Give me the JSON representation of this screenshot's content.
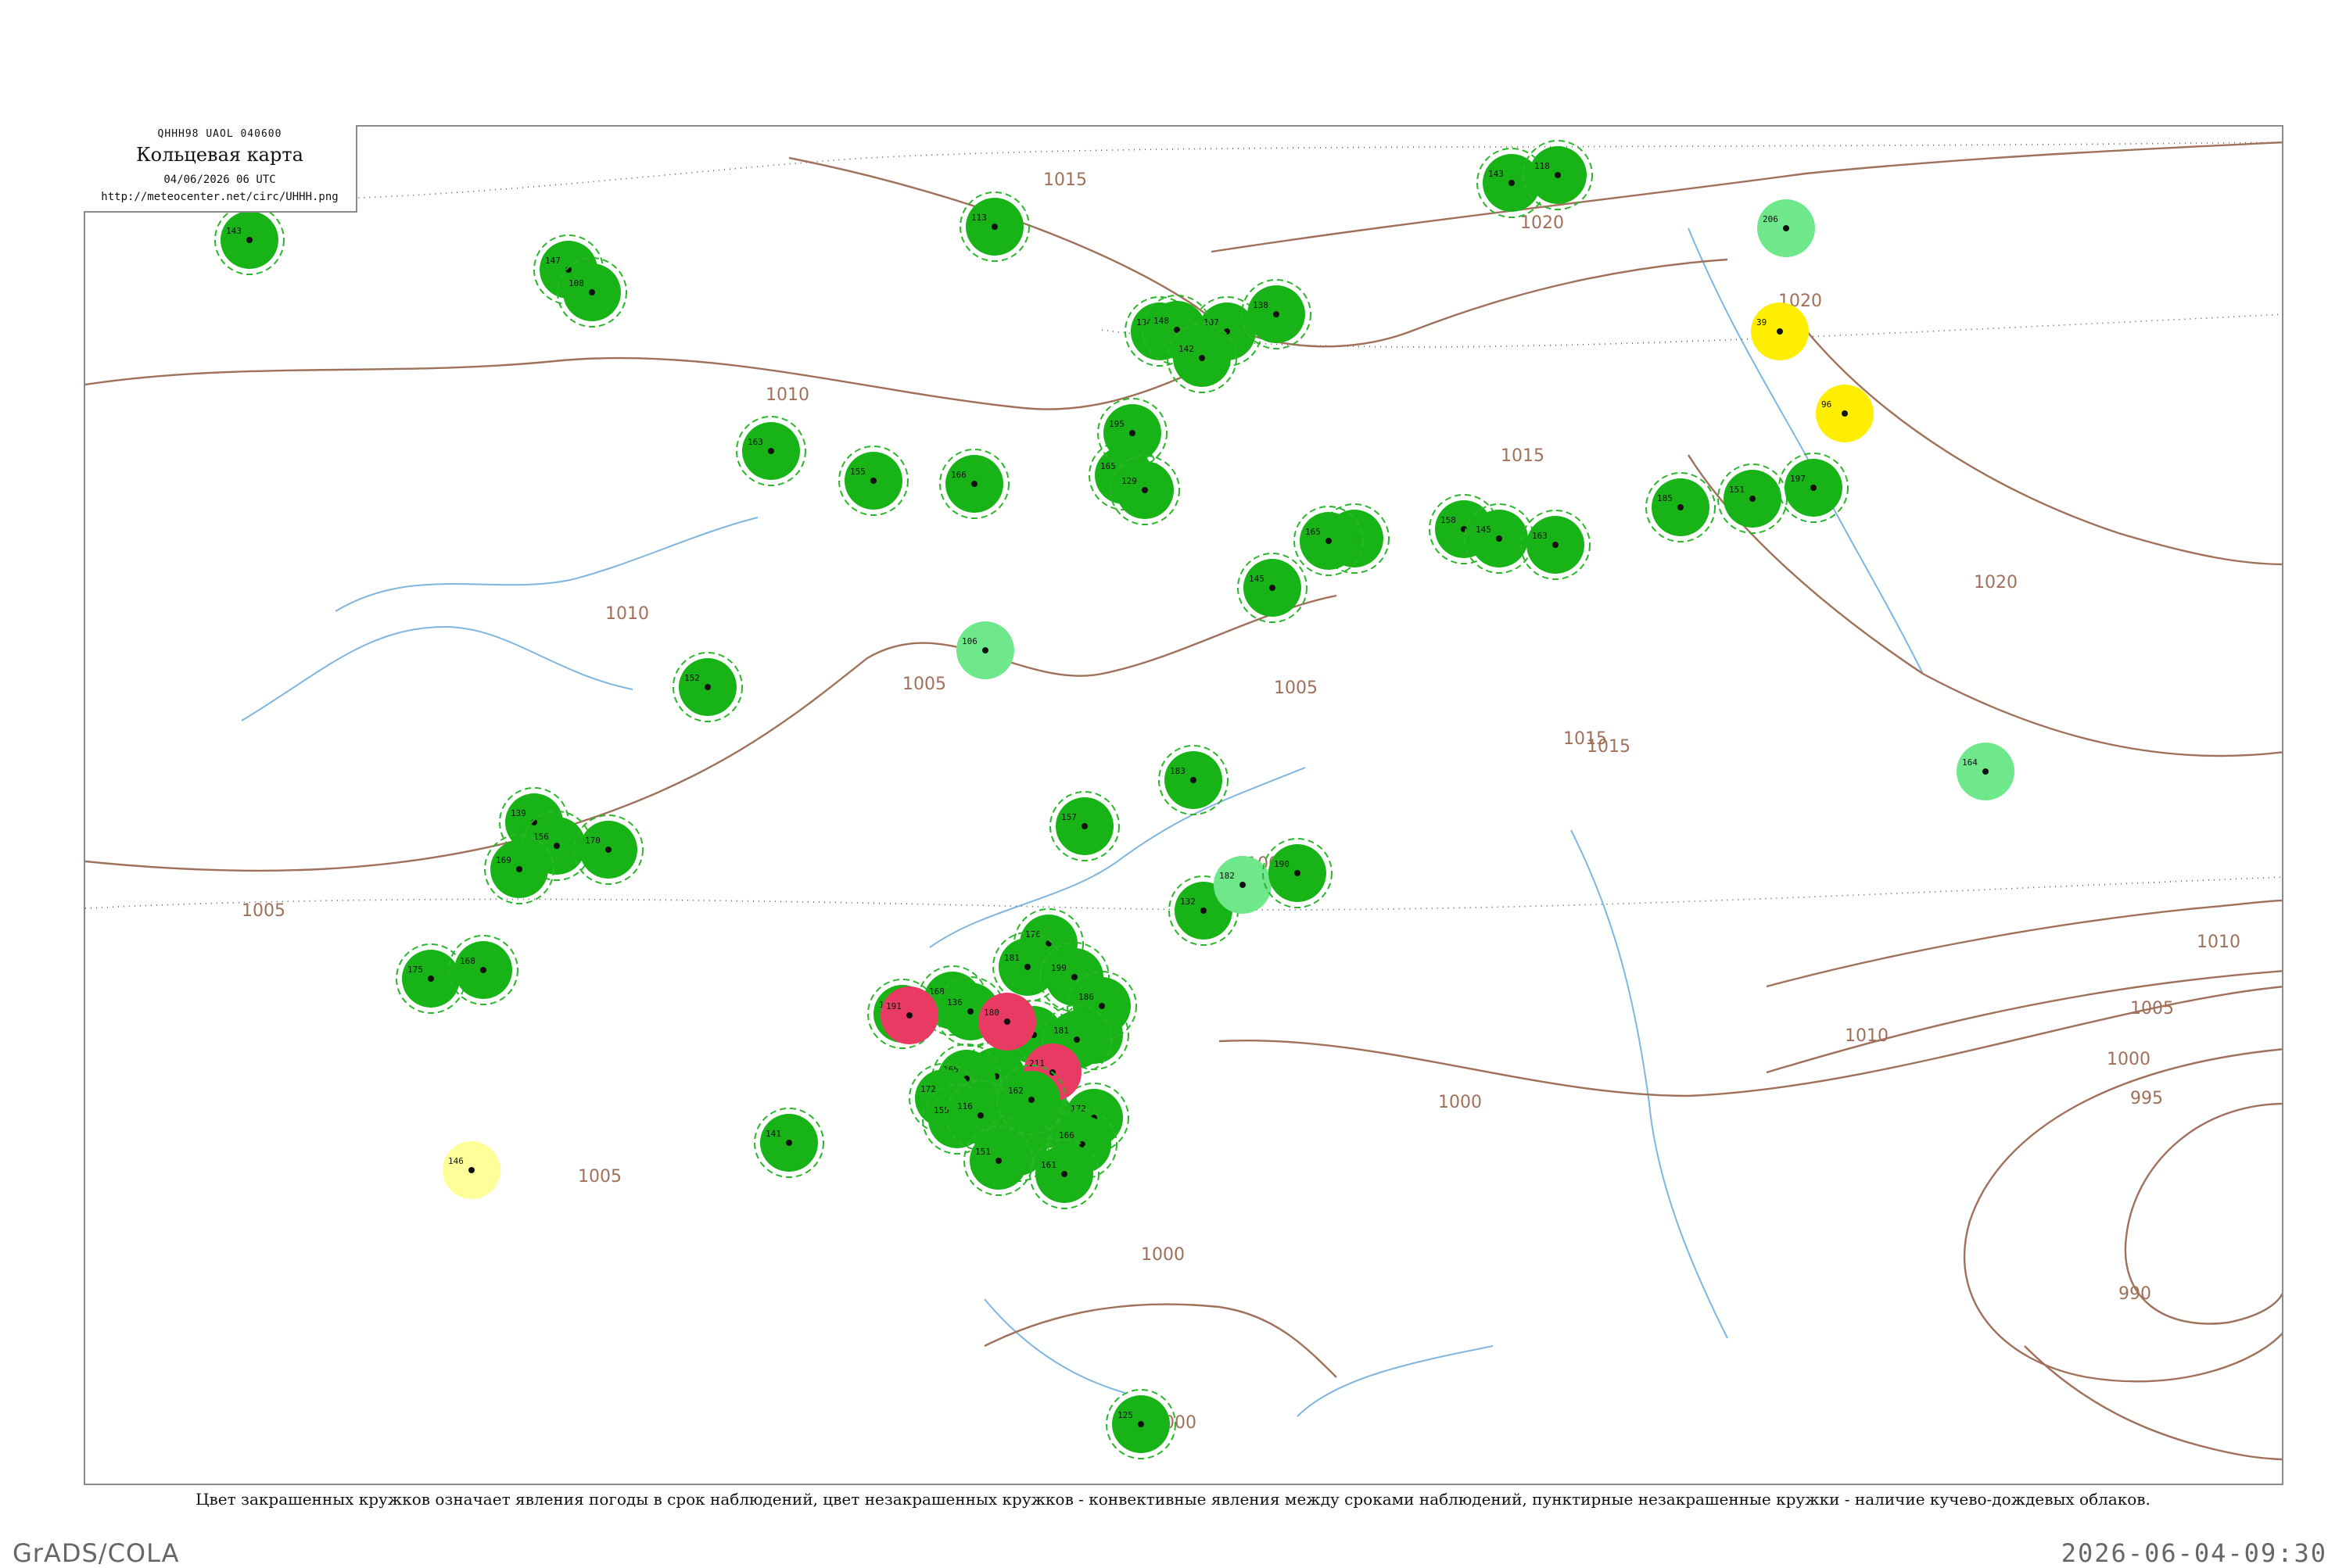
{
  "header": {
    "bulletin": "QHHH98  UAOL  040600",
    "title": "Кольцевая карта",
    "datetime": "04/06/2026 06 UTC",
    "url": "http://meteocenter.net/circ/UHHH.png"
  },
  "legend_caption": "Цвет закрашенных кружков означает явления погоды в срок наблюдений, цвет незакрашенных кружков - конвективные явления между сроками наблюдений, пунктирные незакрашенные кружки - наличие кучево-дождевых облаков.",
  "footer": {
    "left": "GrADS/COLA",
    "right": "2026-06-04-09:30"
  },
  "colors": {
    "isobar": "#a0705a",
    "river": "#7fb6e0",
    "rain": "#17b317",
    "shower_light": "#6ee88a",
    "thunderstorm": "#e83a63",
    "haze_yellow": "#ffee00",
    "pale_yellow": "#ffff99",
    "cb_halo": "#2bb52b"
  },
  "isobars": [
    {
      "label": "1020",
      "value": 1020
    },
    {
      "label": "1015",
      "value": 1015
    },
    {
      "label": "1010",
      "value": 1010
    },
    {
      "label": "1005",
      "value": 1005
    },
    {
      "label": "1000",
      "value": 1000
    },
    {
      "label": "995",
      "value": 995
    },
    {
      "label": "990",
      "value": 990
    }
  ],
  "isobar_labels": [
    {
      "text": "1015",
      "value": 1015
    },
    {
      "text": "1020",
      "value": 1020
    },
    {
      "text": "1020",
      "value": 1020
    },
    {
      "text": "1010",
      "value": 1010
    },
    {
      "text": "1015",
      "value": 1015
    },
    {
      "text": "1010",
      "value": 1010
    },
    {
      "text": "1005",
      "value": 1005
    },
    {
      "text": "1005",
      "value": 1005
    },
    {
      "text": "1015",
      "value": 1015
    },
    {
      "text": "1020",
      "value": 1020
    },
    {
      "text": "1015",
      "value": 1015
    },
    {
      "text": "1010",
      "value": 1010
    },
    {
      "text": "1005",
      "value": 1005
    },
    {
      "text": "1000",
      "value": 1000
    },
    {
      "text": "995",
      "value": 995
    },
    {
      "text": "990",
      "value": 990
    },
    {
      "text": "1000",
      "value": 1000
    },
    {
      "text": "1000",
      "value": 1000
    },
    {
      "text": "1000",
      "value": 1000
    },
    {
      "text": "1005",
      "value": 1005
    },
    {
      "text": "1010",
      "value": 1010
    },
    {
      "text": "1005",
      "value": 1005
    },
    {
      "text": "1005",
      "value": 1005
    }
  ],
  "stations": [
    {
      "label": "143",
      "phenomenon": "rain"
    },
    {
      "label": "147",
      "phenomenon": "rain"
    },
    {
      "label": "108",
      "phenomenon": "rain"
    },
    {
      "label": "113",
      "phenomenon": "rain"
    },
    {
      "label": "107",
      "phenomenon": "rain"
    },
    {
      "label": "134",
      "phenomenon": "rain"
    },
    {
      "label": "148",
      "phenomenon": "rain"
    },
    {
      "label": "142",
      "phenomenon": "rain"
    },
    {
      "label": "138",
      "phenomenon": "rain"
    },
    {
      "label": "143",
      "phenomenon": "rain"
    },
    {
      "label": "118",
      "phenomenon": "rain"
    },
    {
      "label": "163",
      "phenomenon": "rain"
    },
    {
      "label": "155",
      "phenomenon": "rain"
    },
    {
      "label": "166",
      "phenomenon": "rain"
    },
    {
      "label": "165",
      "phenomenon": "rain"
    },
    {
      "label": "195",
      "phenomenon": "rain"
    },
    {
      "label": "129",
      "phenomenon": "rain"
    },
    {
      "label": "145",
      "phenomenon": "rain"
    },
    {
      "label": "171",
      "phenomenon": "rain"
    },
    {
      "label": "165",
      "phenomenon": "rain"
    },
    {
      "label": "158",
      "phenomenon": "rain"
    },
    {
      "label": "145",
      "phenomenon": "rain"
    },
    {
      "label": "163",
      "phenomenon": "rain"
    },
    {
      "label": "185",
      "phenomenon": "rain"
    },
    {
      "label": "151",
      "phenomenon": "rain"
    },
    {
      "label": "197",
      "phenomenon": "rain"
    },
    {
      "label": "152",
      "phenomenon": "rain"
    },
    {
      "label": "139",
      "phenomenon": "rain"
    },
    {
      "label": "156",
      "phenomenon": "rain"
    },
    {
      "label": "169",
      "phenomenon": "rain"
    },
    {
      "label": "170",
      "phenomenon": "rain"
    },
    {
      "label": "175",
      "phenomenon": "rain"
    },
    {
      "label": "168",
      "phenomenon": "rain"
    },
    {
      "label": "183",
      "phenomenon": "rain"
    },
    {
      "label": "157",
      "phenomenon": "rain"
    },
    {
      "label": "132",
      "phenomenon": "rain"
    },
    {
      "label": "168",
      "phenomenon": "rain"
    },
    {
      "label": "166",
      "phenomenon": "rain"
    },
    {
      "label": "136",
      "phenomenon": "rain"
    },
    {
      "label": "176",
      "phenomenon": "rain"
    },
    {
      "label": "181",
      "phenomenon": "rain"
    },
    {
      "label": "199",
      "phenomenon": "rain"
    },
    {
      "label": "167",
      "phenomenon": "rain"
    },
    {
      "label": "178",
      "phenomenon": "rain"
    },
    {
      "label": "186",
      "phenomenon": "rain"
    },
    {
      "label": "181",
      "phenomenon": "rain"
    },
    {
      "label": "148",
      "phenomenon": "rain"
    },
    {
      "label": "165",
      "phenomenon": "rain"
    },
    {
      "label": "172",
      "phenomenon": "rain"
    },
    {
      "label": "155",
      "phenomenon": "rain"
    },
    {
      "label": "116",
      "phenomenon": "rain"
    },
    {
      "label": "168",
      "phenomenon": "rain"
    },
    {
      "label": "172",
      "phenomenon": "rain"
    },
    {
      "label": "166",
      "phenomenon": "rain"
    },
    {
      "label": "174",
      "phenomenon": "rain"
    },
    {
      "label": "161",
      "phenomenon": "rain"
    },
    {
      "label": "141",
      "phenomenon": "rain"
    },
    {
      "label": "206",
      "phenomenon": "shower_light"
    },
    {
      "label": "164",
      "phenomenon": "shower_light"
    },
    {
      "label": "106",
      "phenomenon": "shower_light"
    },
    {
      "label": "182",
      "phenomenon": "shower_light"
    },
    {
      "label": "39",
      "phenomenon": "haze_yellow"
    },
    {
      "label": "96",
      "phenomenon": "haze_yellow"
    },
    {
      "label": "146",
      "phenomenon": "pale_yellow"
    },
    {
      "label": "180",
      "phenomenon": "thunderstorm"
    },
    {
      "label": "211",
      "phenomenon": "thunderstorm"
    },
    {
      "label": "191",
      "phenomenon": "thunderstorm"
    },
    {
      "label": "190",
      "phenomenon": "rain"
    },
    {
      "label": "151",
      "phenomenon": "rain"
    },
    {
      "label": "162",
      "phenomenon": "rain"
    },
    {
      "label": "125",
      "phenomenon": "rain"
    }
  ]
}
